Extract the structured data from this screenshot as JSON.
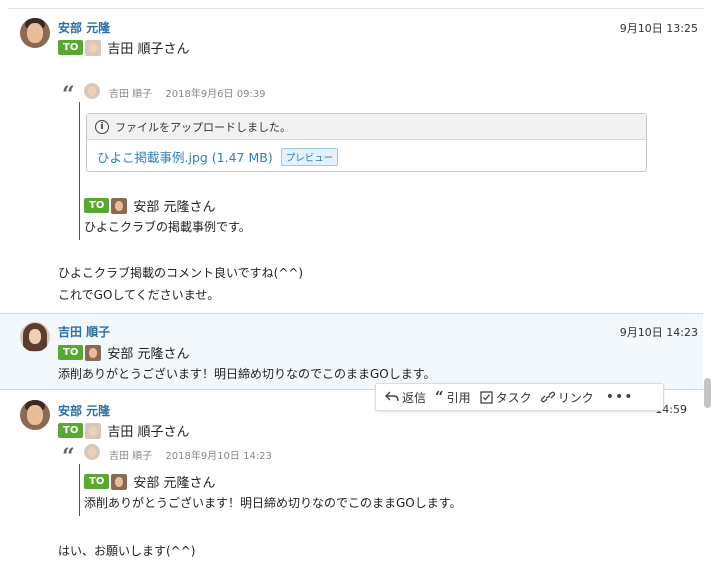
{
  "messages": [
    {
      "sender": "安部 元隆",
      "time": "9月10日 13:25",
      "to_badge": "TO",
      "to_name": "吉田 順子さん",
      "quote": {
        "author": "吉田 順子",
        "date": "2018年9月6日 09:39",
        "file_notice": "ファイルをアップロードしました。",
        "file_link": "ひよこ掲載事例.jpg (1.47 MB)",
        "preview_label": "プレビュー",
        "to_badge": "TO",
        "to_name": "安部 元隆さん",
        "text": "ひよこクラブの掲載事例です。"
      },
      "lines": [
        "ひよこクラブ掲載のコメント良いですね(^^)",
        "これでGOしてくださいませ。"
      ]
    },
    {
      "sender": "吉田 順子",
      "time": "9月10日 14:23",
      "to_badge": "TO",
      "to_name": "安部 元隆さん",
      "lines": [
        "添削ありがとうございます！明日締め切りなのでこのままGOします。"
      ]
    },
    {
      "sender": "安部 元隆",
      "time": "14:59",
      "to_badge": "TO",
      "to_name": "吉田 順子さん",
      "quote": {
        "author": "吉田 順子",
        "date": "2018年9月10日 14:23",
        "to_badge": "TO",
        "to_name": "安部 元隆さん",
        "text": "添削ありがとうございます！明日締め切りなのでこのままGOします。"
      },
      "lines": [
        "はい、お願いします(^^)"
      ]
    }
  ],
  "actions": {
    "reply": "返信",
    "quote": "引用",
    "task": "タスク",
    "link": "リンク",
    "more": "•••"
  },
  "icons": [
    "reply-icon",
    "quote-icon",
    "task-checkbox-icon",
    "link-icon",
    "more-icon",
    "info-icon"
  ]
}
